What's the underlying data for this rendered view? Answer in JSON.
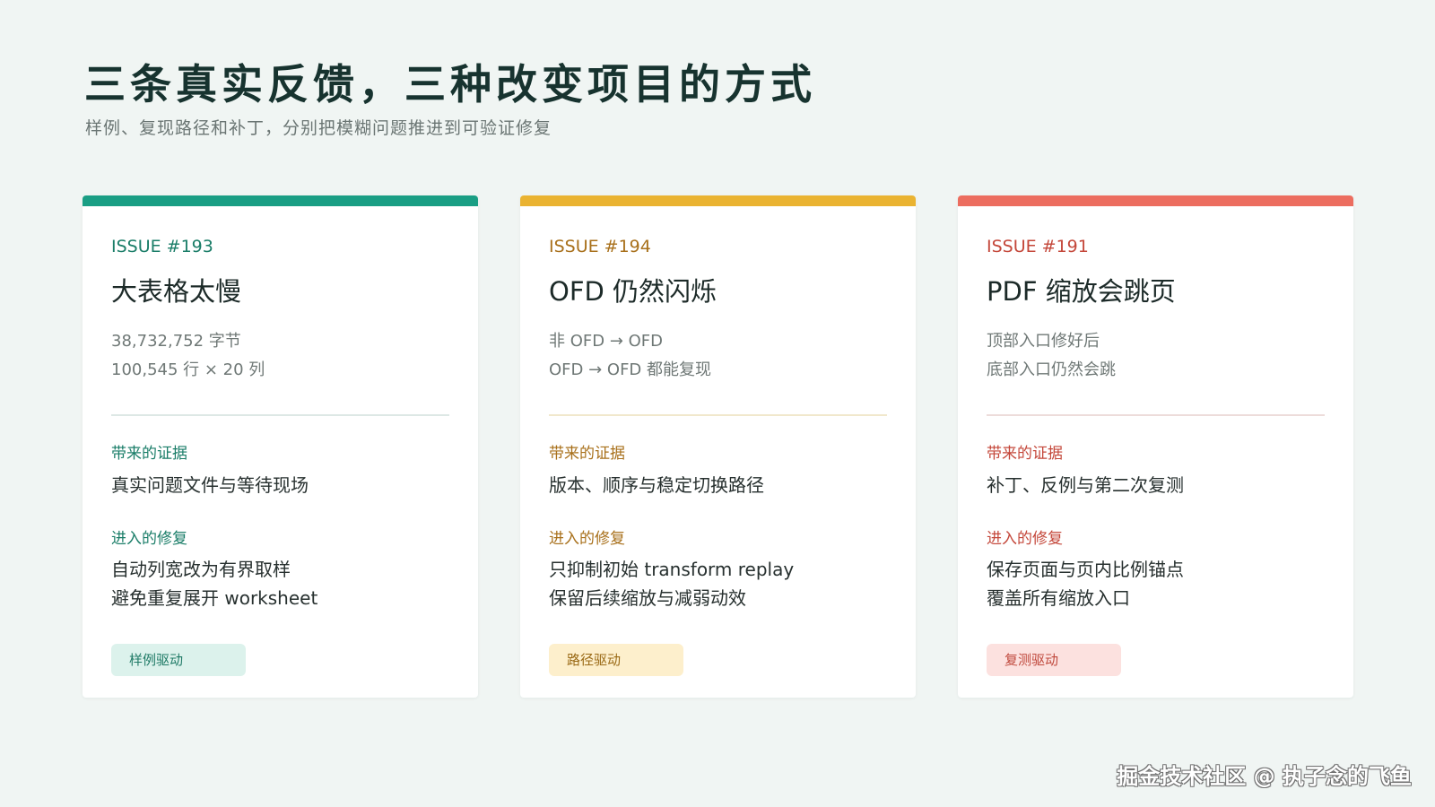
{
  "header": {
    "title": "三条真实反馈，三种改变项目的方式",
    "subtitle": "样例、复现路径和补丁，分别把模糊问题推进到可验证修复"
  },
  "cards": [
    {
      "issue": "ISSUE #193",
      "title": "大表格太慢",
      "meta": [
        "38,732,752 字节",
        "100,545 行 × 20 列"
      ],
      "evidence_label": "带来的证据",
      "evidence": "真实问题文件与等待现场",
      "fix_label": "进入的修复",
      "fixes": [
        "自动列宽改为有界取样",
        "避免重复展开 worksheet"
      ],
      "tag": "样例驱动",
      "colors": {
        "accent": "#1a9e84",
        "text": "#1a7d68",
        "divider": "#dde8e5",
        "tag_bg": "#dcf2ec",
        "tag_text": "#1f7a66"
      }
    },
    {
      "issue": "ISSUE #194",
      "title": "OFD 仍然闪烁",
      "meta": [
        "非 OFD → OFD",
        "OFD → OFD 都能复现"
      ],
      "evidence_label": "带来的证据",
      "evidence": "版本、顺序与稳定切换路径",
      "fix_label": "进入的修复",
      "fixes": [
        "只抑制初始 transform replay",
        "保留后续缩放与减弱动效"
      ],
      "tag": "路径驱动",
      "colors": {
        "accent": "#eab331",
        "text": "#a8701b",
        "divider": "#f1e8cc",
        "tag_bg": "#fdefcc",
        "tag_text": "#9a6a16"
      }
    },
    {
      "issue": "ISSUE #191",
      "title": "PDF 缩放会跳页",
      "meta": [
        "顶部入口修好后",
        "底部入口仍然会跳"
      ],
      "evidence_label": "带来的证据",
      "evidence": "补丁、反例与第二次复测",
      "fix_label": "进入的修复",
      "fixes": [
        "保存页面与页内比例锚点",
        "覆盖所有缩放入口"
      ],
      "tag": "复测驱动",
      "colors": {
        "accent": "#ec6d5f",
        "text": "#c4473a",
        "divider": "#eddcda",
        "tag_bg": "#fce1df",
        "tag_text": "#c0493d"
      }
    }
  ],
  "watermark": "掘金技术社区 @ 执子念的飞鱼"
}
